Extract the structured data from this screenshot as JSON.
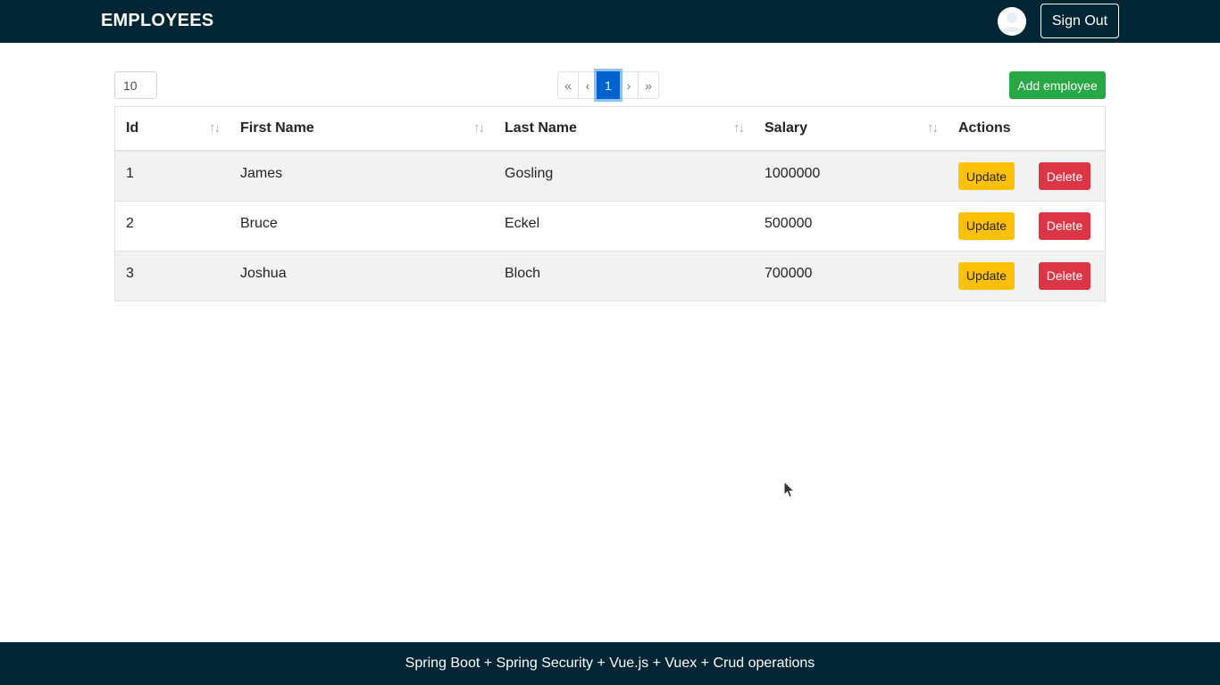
{
  "navbar": {
    "brand": "EMPLOYEES",
    "avatar_icon": "user-avatar-icon",
    "signout_label": "Sign Out"
  },
  "toolbar": {
    "page_size_value": "10",
    "pagination": {
      "first": "«",
      "prev": "‹",
      "current": "1",
      "next": "›",
      "last": "»"
    },
    "add_label": "Add employee"
  },
  "table": {
    "columns": [
      "Id",
      "First Name",
      "Last Name",
      "Salary",
      "Actions"
    ],
    "sort_icon": "↑↓",
    "rows": [
      {
        "id": "1",
        "first_name": "James",
        "last_name": "Gosling",
        "salary": "1000000"
      },
      {
        "id": "2",
        "first_name": "Bruce",
        "last_name": "Eckel",
        "salary": "500000"
      },
      {
        "id": "3",
        "first_name": "Joshua",
        "last_name": "Bloch",
        "salary": "700000"
      }
    ],
    "update_label": "Update",
    "delete_label": "Delete"
  },
  "footer": {
    "text": "Spring Boot + Spring Security + Vue.js + Vuex + Crud operations"
  },
  "colors": {
    "navbar_bg": "#002635",
    "success": "#28a745",
    "warning": "#ffc107",
    "danger": "#dc3545",
    "primary": "#0062cc"
  }
}
